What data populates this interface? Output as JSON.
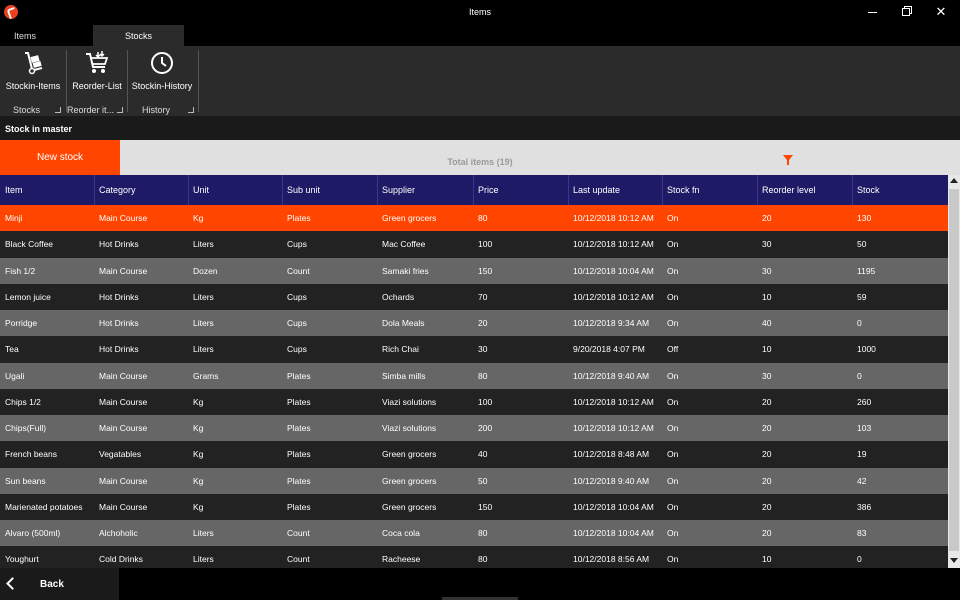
{
  "window": {
    "title": "Items"
  },
  "ribbon": {
    "tabs": [
      {
        "label": "Items",
        "active": false
      },
      {
        "label": "Stocks",
        "active": true
      }
    ],
    "groups": [
      {
        "label": "Stocks",
        "button_label": "Stockin-Items",
        "icon": "hand-truck-icon"
      },
      {
        "label": "Reorder it...",
        "button_label": "Reorder-List",
        "icon": "cart-icon"
      },
      {
        "label": "History",
        "button_label": "Stockin-History",
        "icon": "clock-icon"
      }
    ]
  },
  "section": {
    "title": "Stock in master"
  },
  "actions": {
    "new_stock_label": "New stock",
    "total_items_label": "Total items (19)",
    "filter_icon": "funnel-icon"
  },
  "grid": {
    "columns": [
      "Item",
      "Category",
      "Unit",
      "Sub unit",
      "Supplier",
      "Price",
      "Last update",
      "Stock fn",
      "Reorder level",
      "Stock"
    ],
    "selected_row": 0,
    "rows": [
      [
        "Minji",
        "Main Course",
        "Kg",
        "Plates",
        "Green grocers",
        "80",
        "10/12/2018 10:12 AM",
        "On",
        "20",
        "130"
      ],
      [
        "Black Coffee",
        "Hot Drinks",
        "Liters",
        "Cups",
        "Mac Coffee",
        "100",
        "10/12/2018 10:12 AM",
        "On",
        "30",
        "50"
      ],
      [
        "Fish 1/2",
        "Main Course",
        "Dozen",
        "Count",
        "Samaki fries",
        "150",
        "10/12/2018 10:04 AM",
        "On",
        "30",
        "1195"
      ],
      [
        "Lemon juice",
        "Hot Drinks",
        "Liters",
        "Cups",
        "Ochards",
        "70",
        "10/12/2018 10:12 AM",
        "On",
        "10",
        "59"
      ],
      [
        "Porridge",
        "Hot Drinks",
        "Liters",
        "Cups",
        "Dola Meals",
        "20",
        "10/12/2018 9:34 AM",
        "On",
        "40",
        "0"
      ],
      [
        "Tea",
        "Hot Drinks",
        "Liters",
        "Cups",
        "Rich Chai",
        "30",
        "9/20/2018 4:07 PM",
        "Off",
        "10",
        "1000"
      ],
      [
        "Ugali",
        "Main Course",
        "Grams",
        "Plates",
        "Simba mills",
        "80",
        "10/12/2018 9:40 AM",
        "On",
        "30",
        "0"
      ],
      [
        "Chips 1/2",
        "Main Course",
        "Kg",
        "Plates",
        "Viazi solutions",
        "100",
        "10/12/2018 10:12 AM",
        "On",
        "20",
        "260"
      ],
      [
        "Chips(Full)",
        "Main Course",
        "Kg",
        "Plates",
        "Viazi solutions",
        "200",
        "10/12/2018 10:12 AM",
        "On",
        "20",
        "103"
      ],
      [
        "French beans",
        "Vegatables",
        "Kg",
        "Plates",
        "Green grocers",
        "40",
        "10/12/2018 8:48 AM",
        "On",
        "20",
        "19"
      ],
      [
        "Sun beans",
        "Main Course",
        "Kg",
        "Plates",
        "Green grocers",
        "50",
        "10/12/2018 9:40 AM",
        "On",
        "20",
        "42"
      ],
      [
        "Marienated potatoes",
        "Main Course",
        "Kg",
        "Plates",
        "Green grocers",
        "150",
        "10/12/2018 10:04 AM",
        "On",
        "20",
        "386"
      ],
      [
        "Alvaro (500ml)",
        "Alchoholic",
        "Liters",
        "Count",
        "Coca cola",
        "80",
        "10/12/2018 10:04 AM",
        "On",
        "20",
        "83"
      ],
      [
        "Youghurt",
        "Cold Drinks",
        "Liters",
        "Count",
        "Racheese",
        "80",
        "10/12/2018 8:56 AM",
        "On",
        "10",
        "0"
      ]
    ]
  },
  "footer": {
    "back_label": "Back"
  },
  "colors": {
    "accent": "#ff4500",
    "header_bg": "#1f1a66",
    "row_dark": "#222222",
    "row_light": "#666666"
  }
}
